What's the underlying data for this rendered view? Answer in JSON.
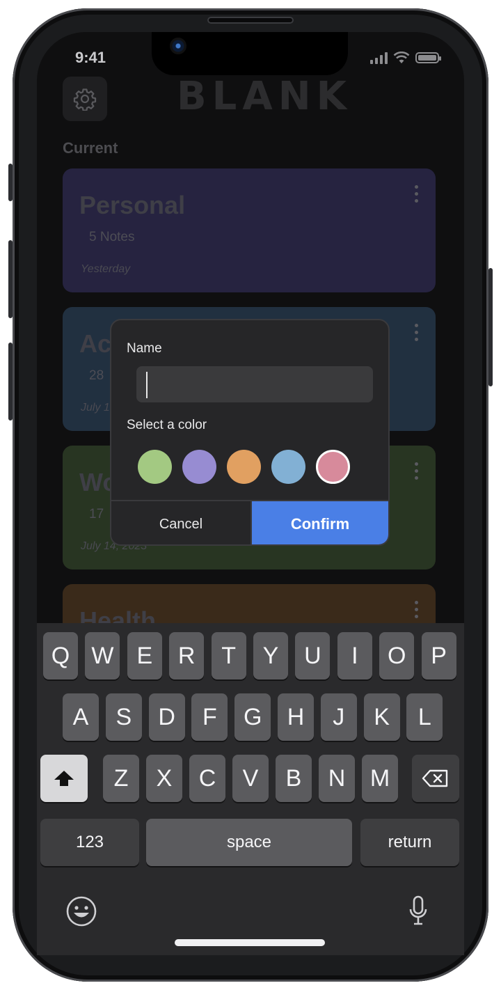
{
  "status_bar": {
    "time": "9:41"
  },
  "app": {
    "logo": "BLANK",
    "section_label": "Current"
  },
  "cards": [
    {
      "title": "Personal",
      "count": "5 Notes",
      "date": "Yesterday",
      "color": "#262340"
    },
    {
      "title": "Ac",
      "count": "28",
      "date": "July 1",
      "color": "#213040"
    },
    {
      "title": "Wo",
      "count": "17",
      "date": "July 14, 2023",
      "color": "#283522"
    },
    {
      "title": "Health",
      "count": "",
      "date": "",
      "color": "#3a2a1a"
    }
  ],
  "dialog": {
    "name_label": "Name",
    "name_value": "",
    "color_label": "Select a color",
    "colors": [
      "#a3c982",
      "#978cd2",
      "#e1a061",
      "#82b0d4",
      "#d78a9b"
    ],
    "selected_color": "#d78a9b",
    "cancel_label": "Cancel",
    "confirm_label": "Confirm"
  },
  "keyboard": {
    "row1": [
      "Q",
      "W",
      "E",
      "R",
      "T",
      "Y",
      "U",
      "I",
      "O",
      "P"
    ],
    "row2": [
      "A",
      "S",
      "D",
      "F",
      "G",
      "H",
      "J",
      "K",
      "L"
    ],
    "row3": [
      "Z",
      "X",
      "C",
      "V",
      "B",
      "N",
      "M"
    ],
    "numbers_label": "123",
    "space_label": "space",
    "return_label": "return"
  }
}
